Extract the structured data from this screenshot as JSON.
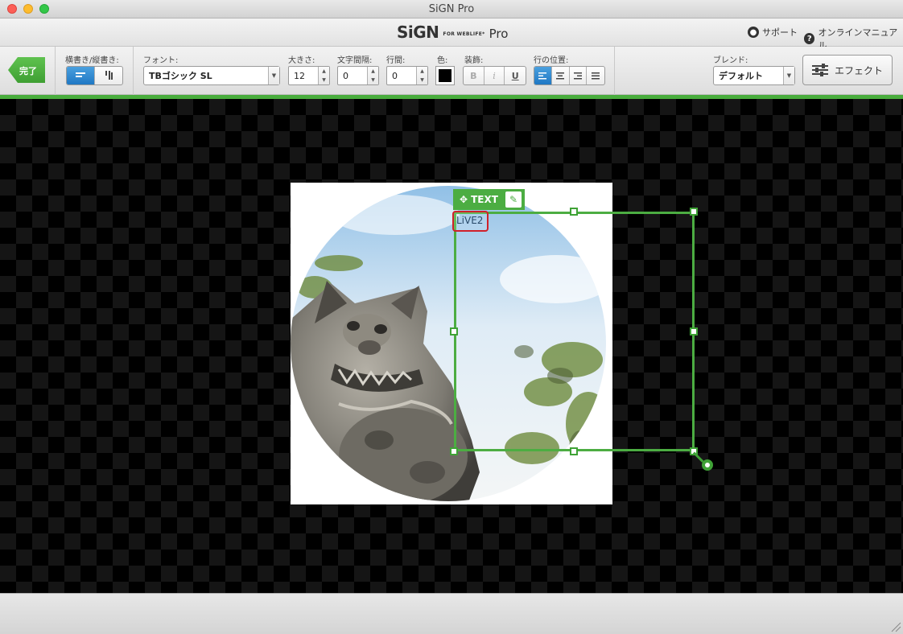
{
  "window": {
    "title": "SiGN Pro"
  },
  "app": {
    "logo_main": "SiGN",
    "logo_sub": "FOR WEBLIFE*",
    "logo_pro": "Pro",
    "support_label": "サポート",
    "manual_label": "オンラインマニュアル"
  },
  "toolbar": {
    "done_label": "完了",
    "orientation_label": "横書き/縦書き:",
    "font_label": "フォント:",
    "font_value": "TBゴシック SL",
    "size_label": "大きさ:",
    "size_value": "12",
    "letter_spacing_label": "文字間隔:",
    "letter_spacing_value": "0",
    "line_spacing_label": "行間:",
    "line_spacing_value": "0",
    "color_label": "色:",
    "color_value": "#000000",
    "decoration_label": "装飾:",
    "bold_label": "B",
    "italic_label": "i",
    "underline_label": "U",
    "align_label": "行の位置:",
    "blend_label": "ブレンド:",
    "blend_value": "デフォルト",
    "effect_label": "エフェクト"
  },
  "canvas": {
    "text_tag_label": "TEXT",
    "text_content": "LiVE2"
  },
  "colors": {
    "accent_green": "#4cad42",
    "selection_blue": "#1f78c4",
    "highlight_red": "#d0202a"
  }
}
